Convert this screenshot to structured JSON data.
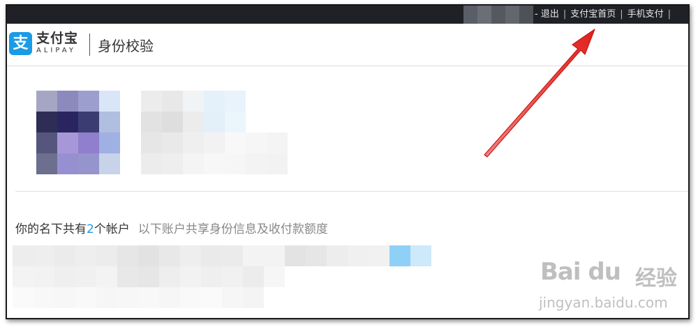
{
  "topbar": {
    "links": [
      {
        "label": "- 退出"
      },
      {
        "label": "支付宝首页"
      },
      {
        "label": "手机支付"
      }
    ]
  },
  "header": {
    "logo_glyph": "支",
    "logo_cn": "支付宝",
    "logo_en": "ALIPAY",
    "page_title": "身份校验"
  },
  "accounts": {
    "prefix": "你的名下共有",
    "count": "2",
    "suffix": "个帐户",
    "note": "以下账户共享身份信息及收付款额度"
  },
  "watermark": {
    "brand": "Bai du",
    "brand_cn": "经验",
    "url": "jingyan.baidu.com"
  },
  "colors": {
    "accent": "#1a9be6",
    "topbar_bg": "#1f2126",
    "arrow": "#e0201c"
  }
}
